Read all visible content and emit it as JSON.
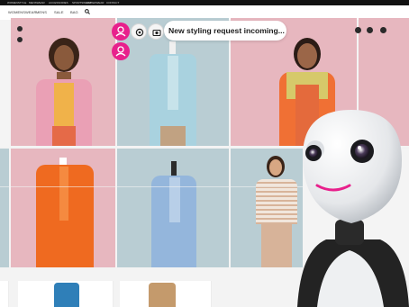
{
  "topbar": {
    "items": [
      "WOMENSTYLE",
      "MENSWEAR",
      "ACCESSORIES",
      "SPORTSWEAR",
      "OUTERWEAR",
      "CONTACT"
    ]
  },
  "nav": {
    "items": [
      "WOMENSWEAR",
      "MENS",
      "SALE",
      "BAG"
    ],
    "search_icon": "search-icon"
  },
  "assistant": {
    "message": "New styling request incoming...",
    "buttons": [
      "user-icon",
      "user-icon"
    ],
    "controls": [
      "record-icon",
      "camera-icon"
    ]
  },
  "colors": {
    "accent": "#e8208c",
    "pink_backdrop": "#e7b7bf",
    "blue_backdrop": "#b9cdd3",
    "navbar": "#121212"
  }
}
